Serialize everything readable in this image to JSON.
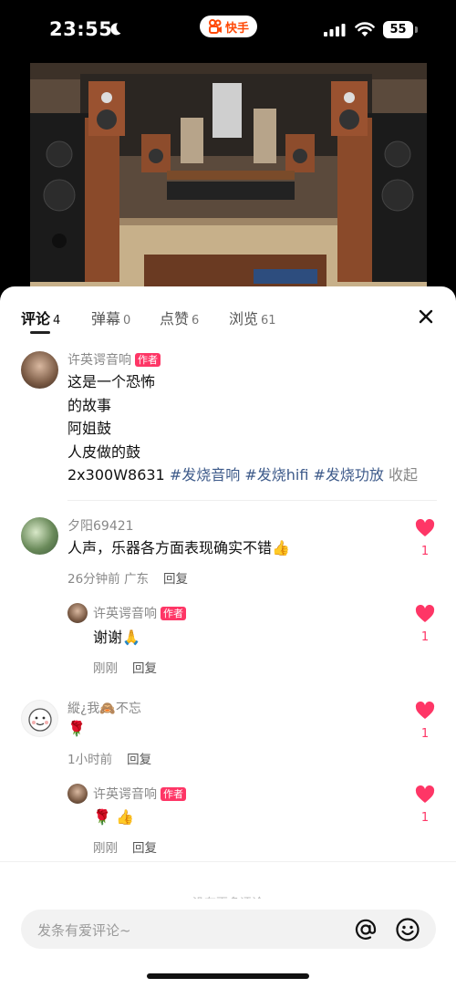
{
  "status_bar": {
    "time": "23:55",
    "app_name": "快手",
    "battery": "55",
    "brand_color": "#ff4906"
  },
  "tabs": [
    {
      "label": "评论",
      "count": "4",
      "active": true
    },
    {
      "label": "弹幕",
      "count": "0"
    },
    {
      "label": "点赞",
      "count": "6"
    },
    {
      "label": "浏览",
      "count": "61"
    }
  ],
  "author_badge": "作者",
  "comments": [
    {
      "user": "许英谔音响",
      "lines": [
        "这是一个恐怖",
        "的故事",
        "阿姐鼓",
        "人皮做的鼓"
      ],
      "last_line_prefix": "2x300W8631 ",
      "hashtags": [
        "#发烧音响",
        "#发烧hifi",
        "#发烧功放"
      ],
      "collapse_label": "收起"
    },
    {
      "user": "夕阳69421",
      "text": "人声，乐器各方面表现确实不错👍",
      "time": "26分钟前 广东",
      "reply_label": "回复",
      "likes": "1"
    },
    {
      "user": "许英谔音响",
      "text": "谢谢🙏",
      "time": "刚刚",
      "reply_label": "回复",
      "likes": "1"
    },
    {
      "user": "縱¿我🙈不忘",
      "text": "🌹",
      "time": "1小时前",
      "reply_label": "回复",
      "likes": "1"
    },
    {
      "user": "许英谔音响",
      "text": "🌹 👍",
      "time": "刚刚",
      "reply_label": "回复",
      "likes": "1"
    }
  ],
  "no_more_text": "没有更多评论",
  "input": {
    "placeholder": "发条有爱评论~"
  },
  "colors": {
    "like": "#fe3666",
    "hashtag": "#3d5a8a",
    "badge": "#fe3666"
  },
  "icons": [
    "moon-icon",
    "kuaishou-logo-icon",
    "signal-icon",
    "wifi-icon",
    "close-icon",
    "heart-icon",
    "at-icon",
    "emoji-icon"
  ]
}
